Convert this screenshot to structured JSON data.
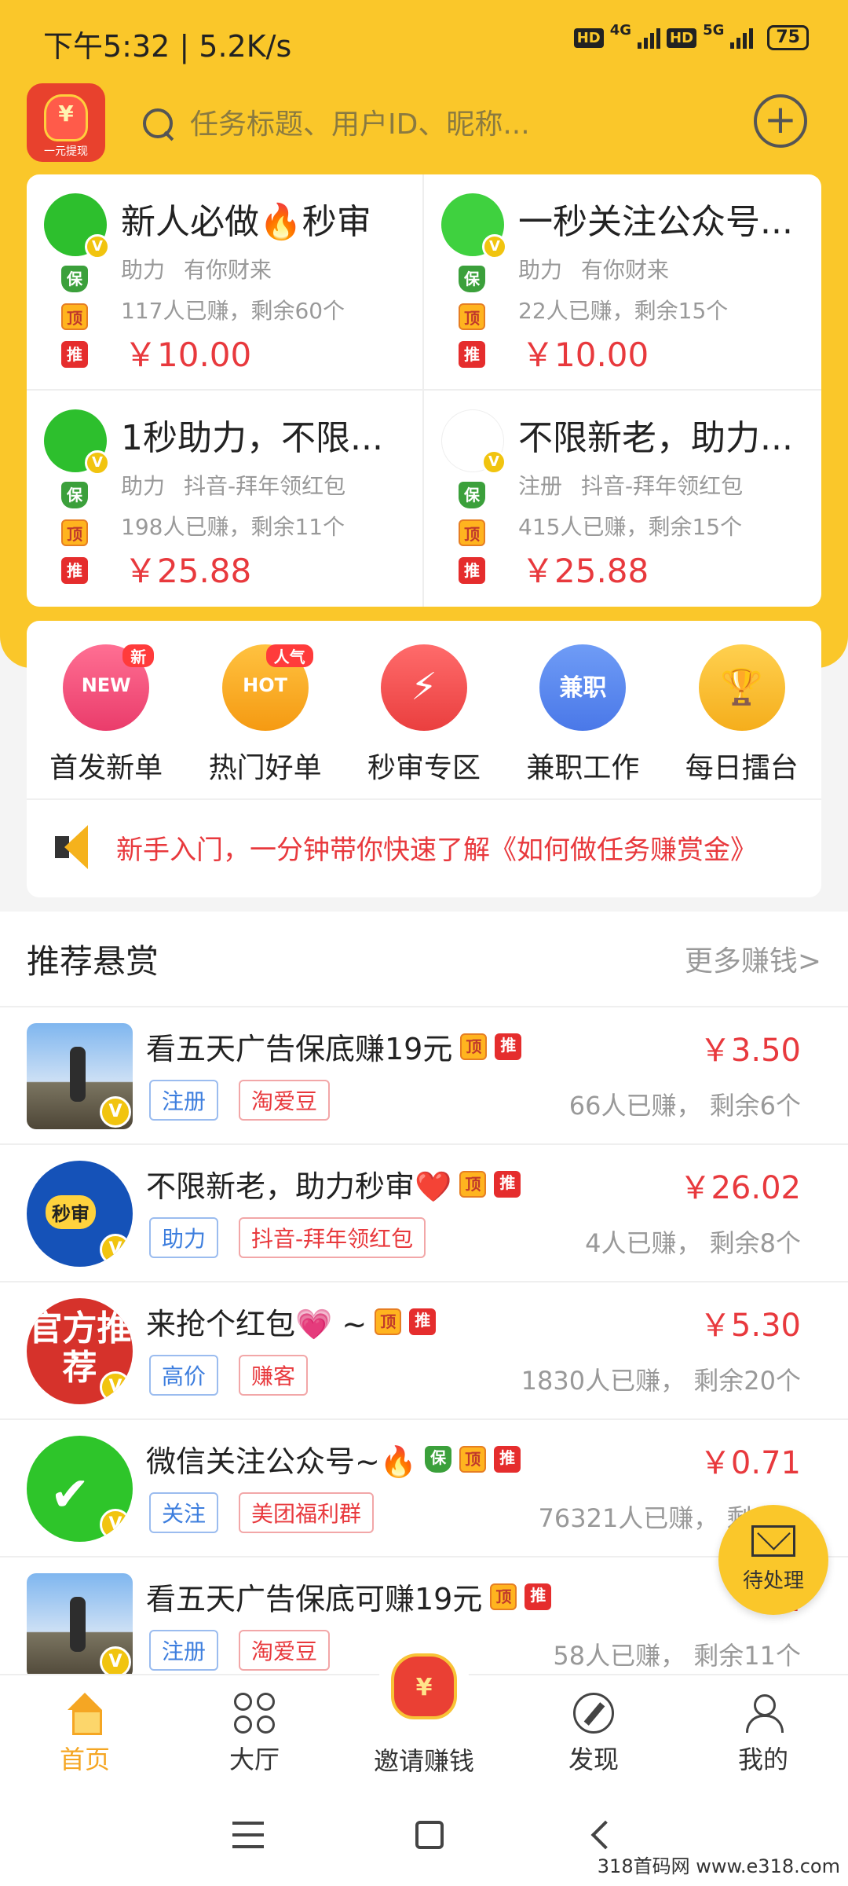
{
  "status_bar": {
    "time": "下午5:32 | 5.2K/s",
    "net1": "4G",
    "net2": "5G",
    "hd": "HD",
    "battery": "75"
  },
  "header": {
    "logo_caption": "一元提现",
    "search_placeholder": "任务标题、用户ID、昵称..."
  },
  "featured": [
    {
      "title": "新人必做🔥秒审",
      "type": "助力",
      "author": "有你财来",
      "stats": "117人已赚，剩余60个",
      "price": "￥10.00"
    },
    {
      "title": "一秒关注公众号...",
      "type": "助力",
      "author": "有你财来",
      "stats": "22人已赚，剩余15个",
      "price": "￥10.00"
    },
    {
      "title": "1秒助力，不限...",
      "type": "助力",
      "author": "抖音-拜年领红包",
      "stats": "198人已赚，剩余11个",
      "price": "￥25.88"
    },
    {
      "title": "不限新老，助力...",
      "type": "注册",
      "author": "抖音-拜年领红包",
      "stats": "415人已赚，剩余15个",
      "price": "￥25.88"
    }
  ],
  "badges": {
    "bao": "保",
    "ding": "顶",
    "tui": "推",
    "v": "V"
  },
  "categories": [
    {
      "label": "首发新单",
      "icon_text": "NEW",
      "pill": "新"
    },
    {
      "label": "热门好单",
      "icon_text": "HOT",
      "pill": "人气"
    },
    {
      "label": "秒审专区",
      "icon_text": "⚡",
      "pill": ""
    },
    {
      "label": "兼职工作",
      "icon_text": "兼职",
      "pill": ""
    },
    {
      "label": "每日擂台",
      "icon_text": "🏆",
      "pill": ""
    }
  ],
  "notice": "新手入门，一分钟带你快速了解《如何做任务赚赏金》",
  "recommend": {
    "title": "推荐悬赏",
    "more": "更多赚钱>",
    "items": [
      {
        "title": "看五天广告保底赚19元",
        "price": "￥3.50",
        "tag1": "注册",
        "tag2": "淘爱豆",
        "stats": "66人已赚， 剩余6个"
      },
      {
        "title": "不限新老，助力秒审❤️",
        "price": "￥26.02",
        "tag1": "助力",
        "tag2": "抖音-拜年领红包",
        "stats": "4人已赚， 剩余8个"
      },
      {
        "title": "来抢个红包💗 ~",
        "price": "￥5.30",
        "tag1": "高价",
        "tag2": "赚客",
        "stats": "1830人已赚， 剩余20个"
      },
      {
        "title": "微信关注公众号~🔥",
        "price": "￥0.71",
        "tag1": "关注",
        "tag2": "美团福利群",
        "stats": "76321人已赚， 剩余..."
      },
      {
        "title": "看五天广告保底可赚19元",
        "price": "￥...",
        "tag1": "注册",
        "tag2": "淘爱豆",
        "stats": "58人已赚， 剩余11个"
      }
    ],
    "thumb2_text": "秒审",
    "thumb3_text": "官方推荐"
  },
  "float_button": "待处理",
  "nav": [
    {
      "label": "首页"
    },
    {
      "label": "大厅"
    },
    {
      "label": "邀请赚钱"
    },
    {
      "label": "发现"
    },
    {
      "label": "我的"
    }
  ],
  "watermark": "318首码网 www.e318.com",
  "colors": {
    "brand_yellow": "#fac72a",
    "price_red": "#e8393d",
    "active_nav": "#f5a623"
  }
}
